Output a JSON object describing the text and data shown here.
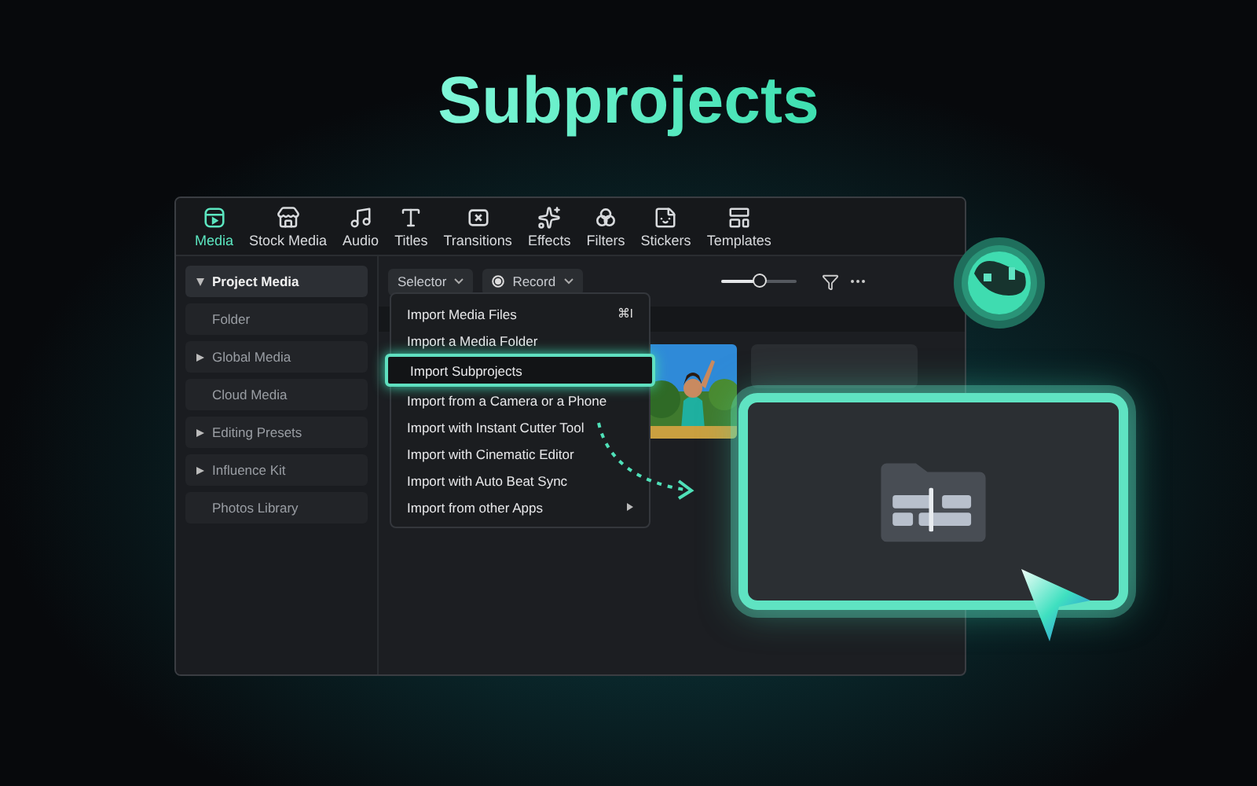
{
  "title": "Subprojects",
  "tabs": [
    {
      "label": "Media",
      "selected": true
    },
    {
      "label": "Stock Media",
      "selected": false
    },
    {
      "label": "Audio",
      "selected": false
    },
    {
      "label": "Titles",
      "selected": false
    },
    {
      "label": "Transitions",
      "selected": false
    },
    {
      "label": "Effects",
      "selected": false
    },
    {
      "label": "Filters",
      "selected": false
    },
    {
      "label": "Stickers",
      "selected": false
    },
    {
      "label": "Templates",
      "selected": false
    }
  ],
  "sidebar": {
    "items": [
      {
        "label": "Project Media",
        "kind": "group",
        "expanded": true,
        "selected": true
      },
      {
        "label": "Folder",
        "kind": "leaf",
        "selected": false
      },
      {
        "label": "Global Media",
        "kind": "group",
        "expanded": false,
        "selected": false
      },
      {
        "label": "Cloud Media",
        "kind": "leaf",
        "selected": false
      },
      {
        "label": "Editing Presets",
        "kind": "group",
        "expanded": false,
        "selected": false
      },
      {
        "label": "Influence Kit",
        "kind": "group",
        "expanded": false,
        "selected": false
      },
      {
        "label": "Photos Library",
        "kind": "leaf",
        "selected": false
      }
    ]
  },
  "toolbar": {
    "dropdowns": [
      "Selector",
      "Record"
    ],
    "zoom": {
      "level": 0.5
    }
  },
  "menu": {
    "items": [
      {
        "label": "Import Media Files",
        "shortcut": "⌘I",
        "submenu": false,
        "selected": false
      },
      {
        "label": "Import a Media Folder",
        "submenu": false,
        "selected": false
      },
      {
        "label": "Import Subprojects",
        "submenu": false,
        "selected": true
      },
      {
        "label": "Import from a Camera or a Phone",
        "submenu": false,
        "selected": false
      },
      {
        "label": "Import with Instant Cutter Tool",
        "submenu": false,
        "selected": false
      },
      {
        "label": "Import with Cinematic Editor",
        "submenu": false,
        "selected": false
      },
      {
        "label": "Import with Auto Beat Sync",
        "submenu": false,
        "selected": false
      },
      {
        "label": "Import from other Apps",
        "submenu": true,
        "selected": false
      }
    ]
  },
  "media": [
    {
      "kind": "picture"
    },
    {
      "kind": "folder"
    }
  ]
}
